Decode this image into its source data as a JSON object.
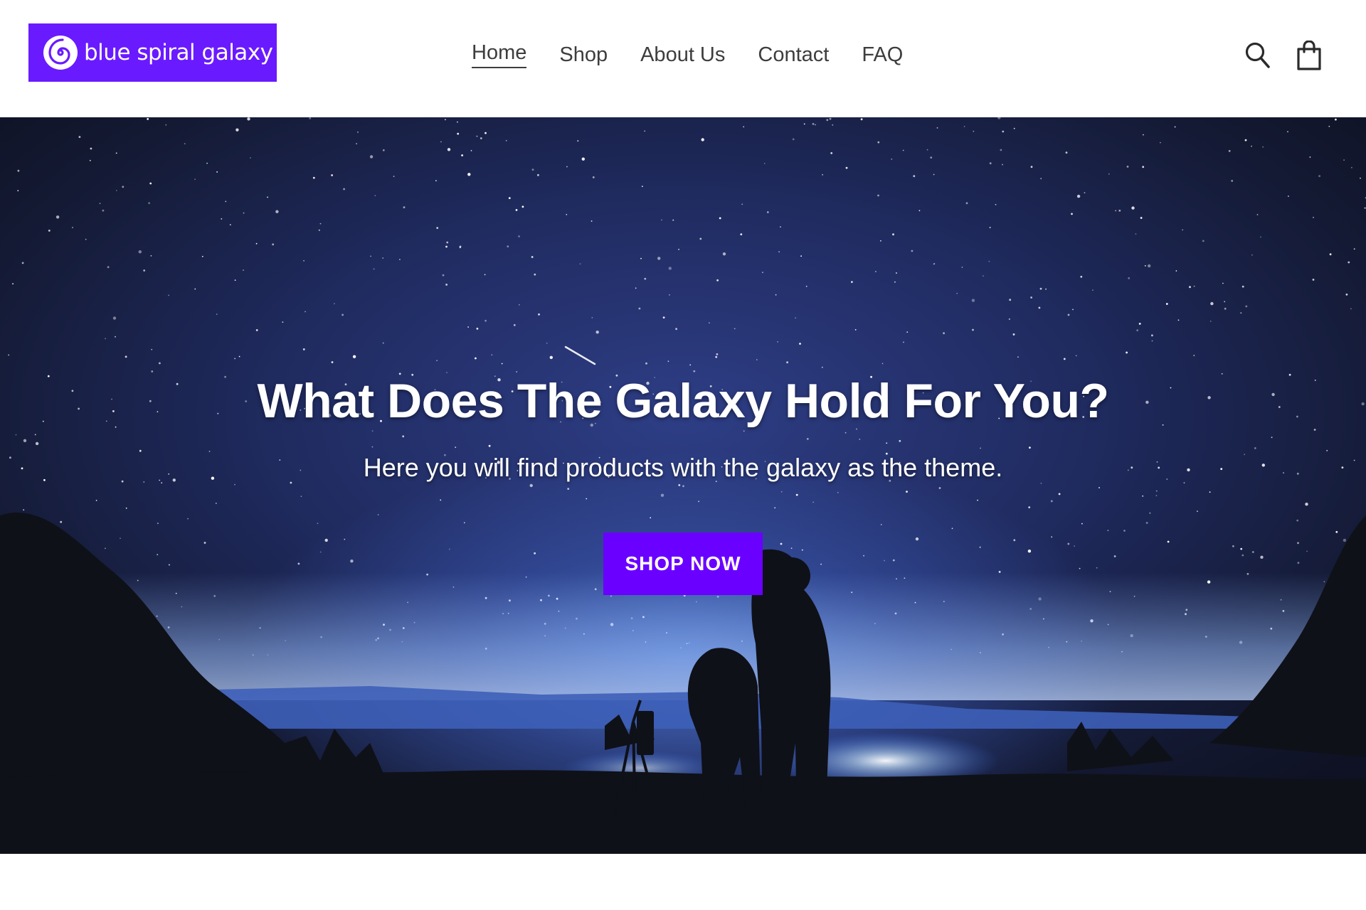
{
  "brand": {
    "name": "blue spiral galaxy",
    "accent_color": "#6a1aff",
    "logo_icon": "spiral-galaxy-icon"
  },
  "nav": {
    "items": [
      {
        "label": "Home",
        "active": true
      },
      {
        "label": "Shop",
        "active": false
      },
      {
        "label": "About Us",
        "active": false
      },
      {
        "label": "Contact",
        "active": false
      },
      {
        "label": "FAQ",
        "active": false
      }
    ]
  },
  "header_icons": {
    "search": "search-icon",
    "cart": "shopping-bag-icon"
  },
  "hero": {
    "title": "What Does The Galaxy Hold For You?",
    "subtitle": "Here you will find products with the galaxy as the theme.",
    "cta_label": "SHOP NOW",
    "cta_color": "#6a00ff"
  }
}
